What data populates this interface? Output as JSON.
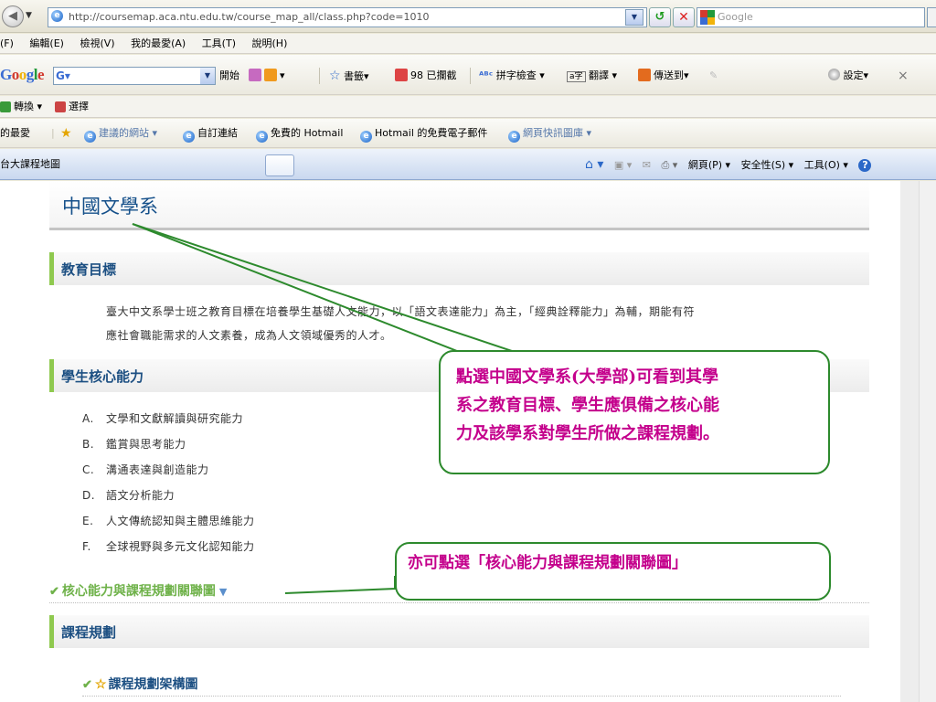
{
  "browser": {
    "url": "http://coursemap.aca.ntu.edu.tw/course_map_all/class.php?code=1010",
    "search_placeholder": "Google",
    "menu": [
      "(F)",
      "編輯(E)",
      "檢視(V)",
      "我的最愛(A)",
      "工具(T)",
      "說明(H)"
    ],
    "google_toolbar": {
      "logo": "Google",
      "logo_letters": [
        "G",
        "o",
        "o",
        "g",
        "l",
        "e"
      ],
      "logo_colors": [
        "#3a6cd3",
        "#d23a2f",
        "#f1b30b",
        "#3a6cd3",
        "#229a3b",
        "#d23a2f"
      ],
      "input_value": "G▾",
      "start_label": "開始",
      "bookmarks_label": "書籤▾",
      "blocked_label": "98 已攔截",
      "spellcheck_label": "拼字檢查 ▾",
      "translate_label": "翻譯 ▾",
      "sendto_label": "傳送到▾",
      "settings_label": "設定▾",
      "close_label": "×"
    },
    "convert_label": "轉換 ▾",
    "select_label": "選擇",
    "favorites": {
      "label": "的最愛",
      "items": [
        "建議的網站 ▾",
        "自訂連結",
        "免費的 Hotmail",
        "Hotmail 的免費電子郵件",
        "網頁快訊圖庫 ▾"
      ]
    },
    "tab_title": "台大課程地圖",
    "tab_tools": [
      "網頁(P) ▾",
      "安全性(S) ▾",
      "工具(O) ▾"
    ]
  },
  "page": {
    "dept_title": "中國文學系",
    "sections": {
      "goal_heading": "教育目標",
      "goal_lines": [
        "臺大中文系學士班之教育目標在培養學生基礎人文能力，以「語文表達能力」為主，「經典詮釋能力」為輔，期能有符",
        "應社會職能需求的人文素養，成為人文領域優秀的人才。"
      ],
      "competency_heading": "學生核心能力",
      "competencies": [
        {
          "letter": "A.",
          "text": "文學和文獻解讀與研究能力"
        },
        {
          "letter": "B.",
          "text": "鑑賞與思考能力"
        },
        {
          "letter": "C.",
          "text": "溝通表達與創造能力"
        },
        {
          "letter": "D.",
          "text": "語文分析能力"
        },
        {
          "letter": "E.",
          "text": "人文傳統認知與主體思維能力"
        },
        {
          "letter": "F.",
          "text": "全球視野與多元文化認知能力"
        }
      ],
      "relation_link": "核心能力與課程規劃關聯圖",
      "plan_heading": "課程規劃",
      "arch_link": "課程規劃架構圖"
    },
    "callouts": {
      "first": [
        "點選中國文學系(大學部)可看到其學",
        "系之教育目標、學生應俱備之核心能",
        "力及該學系對學生所做之課程規劃。"
      ],
      "second": "亦可點選「核心能力與課程規劃關聯圖」"
    }
  },
  "colors": {
    "dept_title": "#15508a",
    "section_accent": "#8fc94f",
    "link_green": "#6fb24a",
    "callout_text": "#c4008c",
    "callout_border": "#2d8a2d"
  }
}
